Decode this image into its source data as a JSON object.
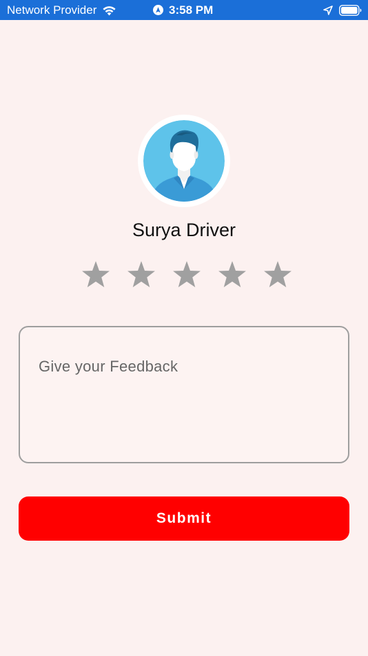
{
  "status_bar": {
    "carrier": "Network Provider",
    "time": "3:58 PM",
    "background": "#1b6fd8",
    "icons": [
      "wifi-icon",
      "location-services-icon",
      "location-arrow-icon",
      "battery-icon"
    ]
  },
  "driver": {
    "name": "Surya Driver",
    "avatar_icon": "driver-avatar-icon"
  },
  "rating": {
    "max": 5,
    "value": 0,
    "star_color": "#a0a0a0"
  },
  "feedback": {
    "placeholder": "Give your Feedback",
    "value": ""
  },
  "submit": {
    "label": "Submit",
    "color": "#ff0000"
  },
  "colors": {
    "page_background": "#fcf1f0",
    "avatar_blue": "#5ec3ea"
  }
}
